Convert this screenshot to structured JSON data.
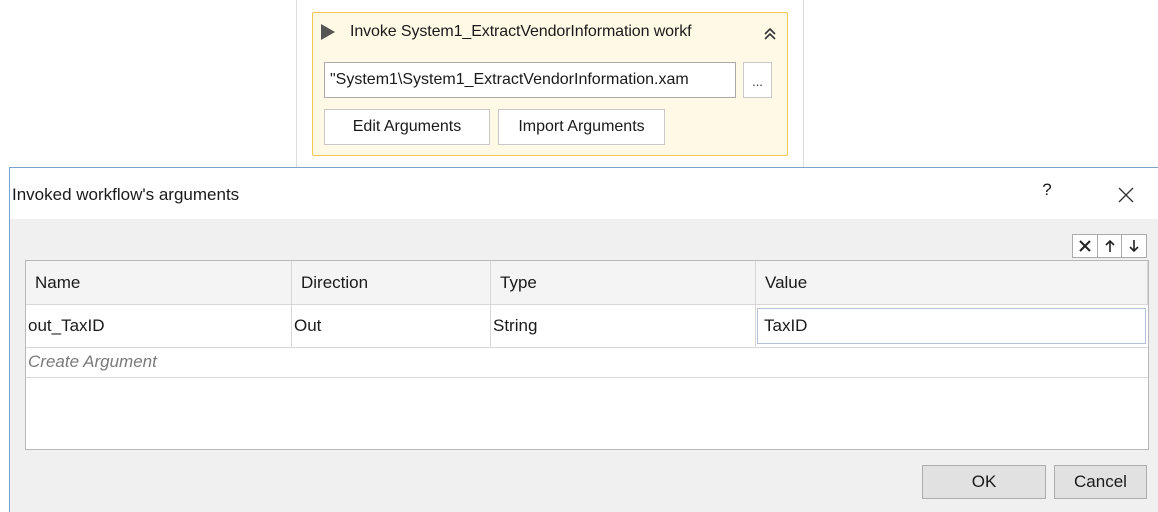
{
  "activity": {
    "title": "Invoke System1_ExtractVendorInformation workf",
    "icon": "play-icon",
    "collapse_icon": "double-chevron-up-icon",
    "workflow_path": "\"System1\\System1_ExtractVendorInformation.xam",
    "browse_label": "...",
    "edit_arguments_label": "Edit Arguments",
    "import_arguments_label": "Import Arguments",
    "colors": {
      "background": "#fff9e6",
      "border": "#f2c94c"
    }
  },
  "dialog": {
    "title": "Invoked workflow's arguments",
    "help_label": "?",
    "close_icon": "close-icon",
    "toolbar": {
      "delete_icon": "delete-x-icon",
      "up_icon": "arrow-up-icon",
      "down_icon": "arrow-down-icon"
    },
    "grid": {
      "columns": [
        "Name",
        "Direction",
        "Type",
        "Value"
      ],
      "rows": [
        {
          "name": "out_TaxID",
          "direction": "Out",
          "type": "String",
          "value": "TaxID"
        }
      ],
      "create_argument_label": "Create Argument"
    },
    "ok_label": "OK",
    "cancel_label": "Cancel",
    "colors": {
      "frame": "#7da2ce",
      "body": "#f0f0f0",
      "button": "#e1e1e1"
    }
  }
}
